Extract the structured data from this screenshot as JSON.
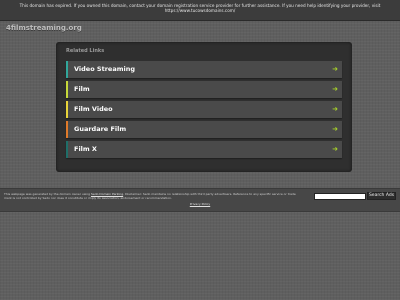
{
  "notice": {
    "text": "This domain has expired. If you owned this domain, contact your domain registration service provider for further assistance. If you need help identifying your provider, visit https://www.tucowsdomains.com/"
  },
  "site": {
    "domain": "4filmstreaming.org"
  },
  "related": {
    "heading": "Related Links",
    "items": [
      {
        "label": "Video Streaming",
        "color": "#31a79b",
        "arrow": "➜"
      },
      {
        "label": "Film",
        "color": "#c6d83a",
        "arrow": "➜"
      },
      {
        "label": "Film Video",
        "color": "#e8d43a",
        "arrow": "➜"
      },
      {
        "label": "Guardare Film",
        "color": "#e07a2a",
        "arrow": "➜"
      },
      {
        "label": "Film X",
        "color": "#1f6f69",
        "arrow": "➜"
      }
    ]
  },
  "footer": {
    "disclaimer_pre": "This webpage was generated by the domain owner using ",
    "disclaimer_link": "Sedo Domain Parking",
    "disclaimer_post": ". Disclaimer: Sedo maintains no relationship with third party advertisers. Reference to any specific service or trade mark is not controlled by Sedo nor does it constitute or imply its association, endorsement or recommendation.",
    "search_button": "Search Ads",
    "search_value": "",
    "privacy": "Privacy Policy"
  },
  "colors": {
    "accent_arrow": "#a7d02a",
    "panel": "#2f2f2f",
    "background": "#5f5f5f"
  }
}
